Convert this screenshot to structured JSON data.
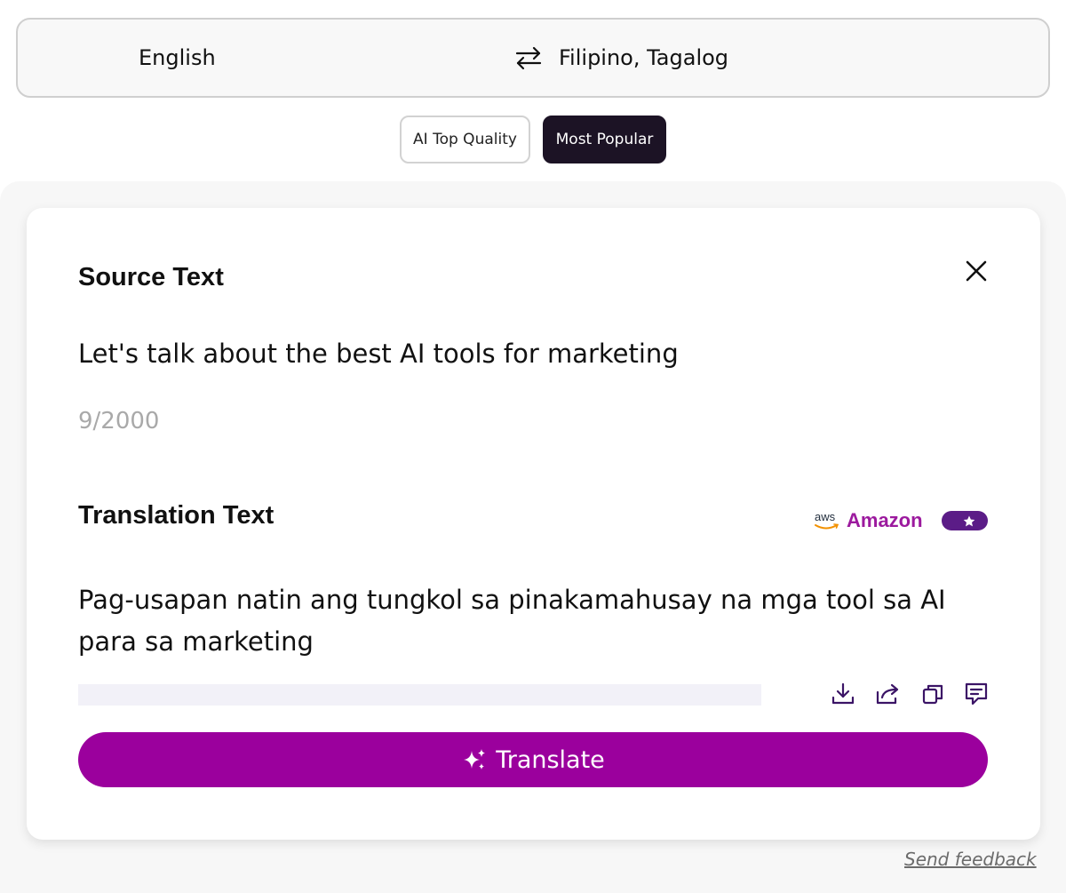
{
  "languages": {
    "source": "English",
    "target": "Filipino, Tagalog",
    "swap_icon": "swap-arrows-icon"
  },
  "modes": {
    "quality_label": "AI Top Quality",
    "popular_label": "Most Popular",
    "selected": "Most Popular"
  },
  "source": {
    "heading": "Source Text",
    "text": "Let's talk about the best AI tools for marketing",
    "char_count": "9/2000",
    "close_icon": "close-icon"
  },
  "translation": {
    "heading": "Translation Text",
    "provider_logo": "aws",
    "provider": "Amazon",
    "text": "Pag-usapan natin ang tungkol sa pinakamahusay na mga tool sa AI para sa marketing",
    "progress": 0,
    "icons": [
      "download-icon",
      "share-icon",
      "copy-icon",
      "feedback-icon"
    ]
  },
  "translate_button": {
    "label": "Translate",
    "icon": "sparkles-icon"
  },
  "footer": {
    "send_feedback": "Send feedback"
  },
  "colors": {
    "accent": "#9b009d",
    "dark": "#1c1325",
    "provider": "#9c1a9e",
    "toggle": "#5b1c87",
    "aws_orange": "#f29100"
  }
}
